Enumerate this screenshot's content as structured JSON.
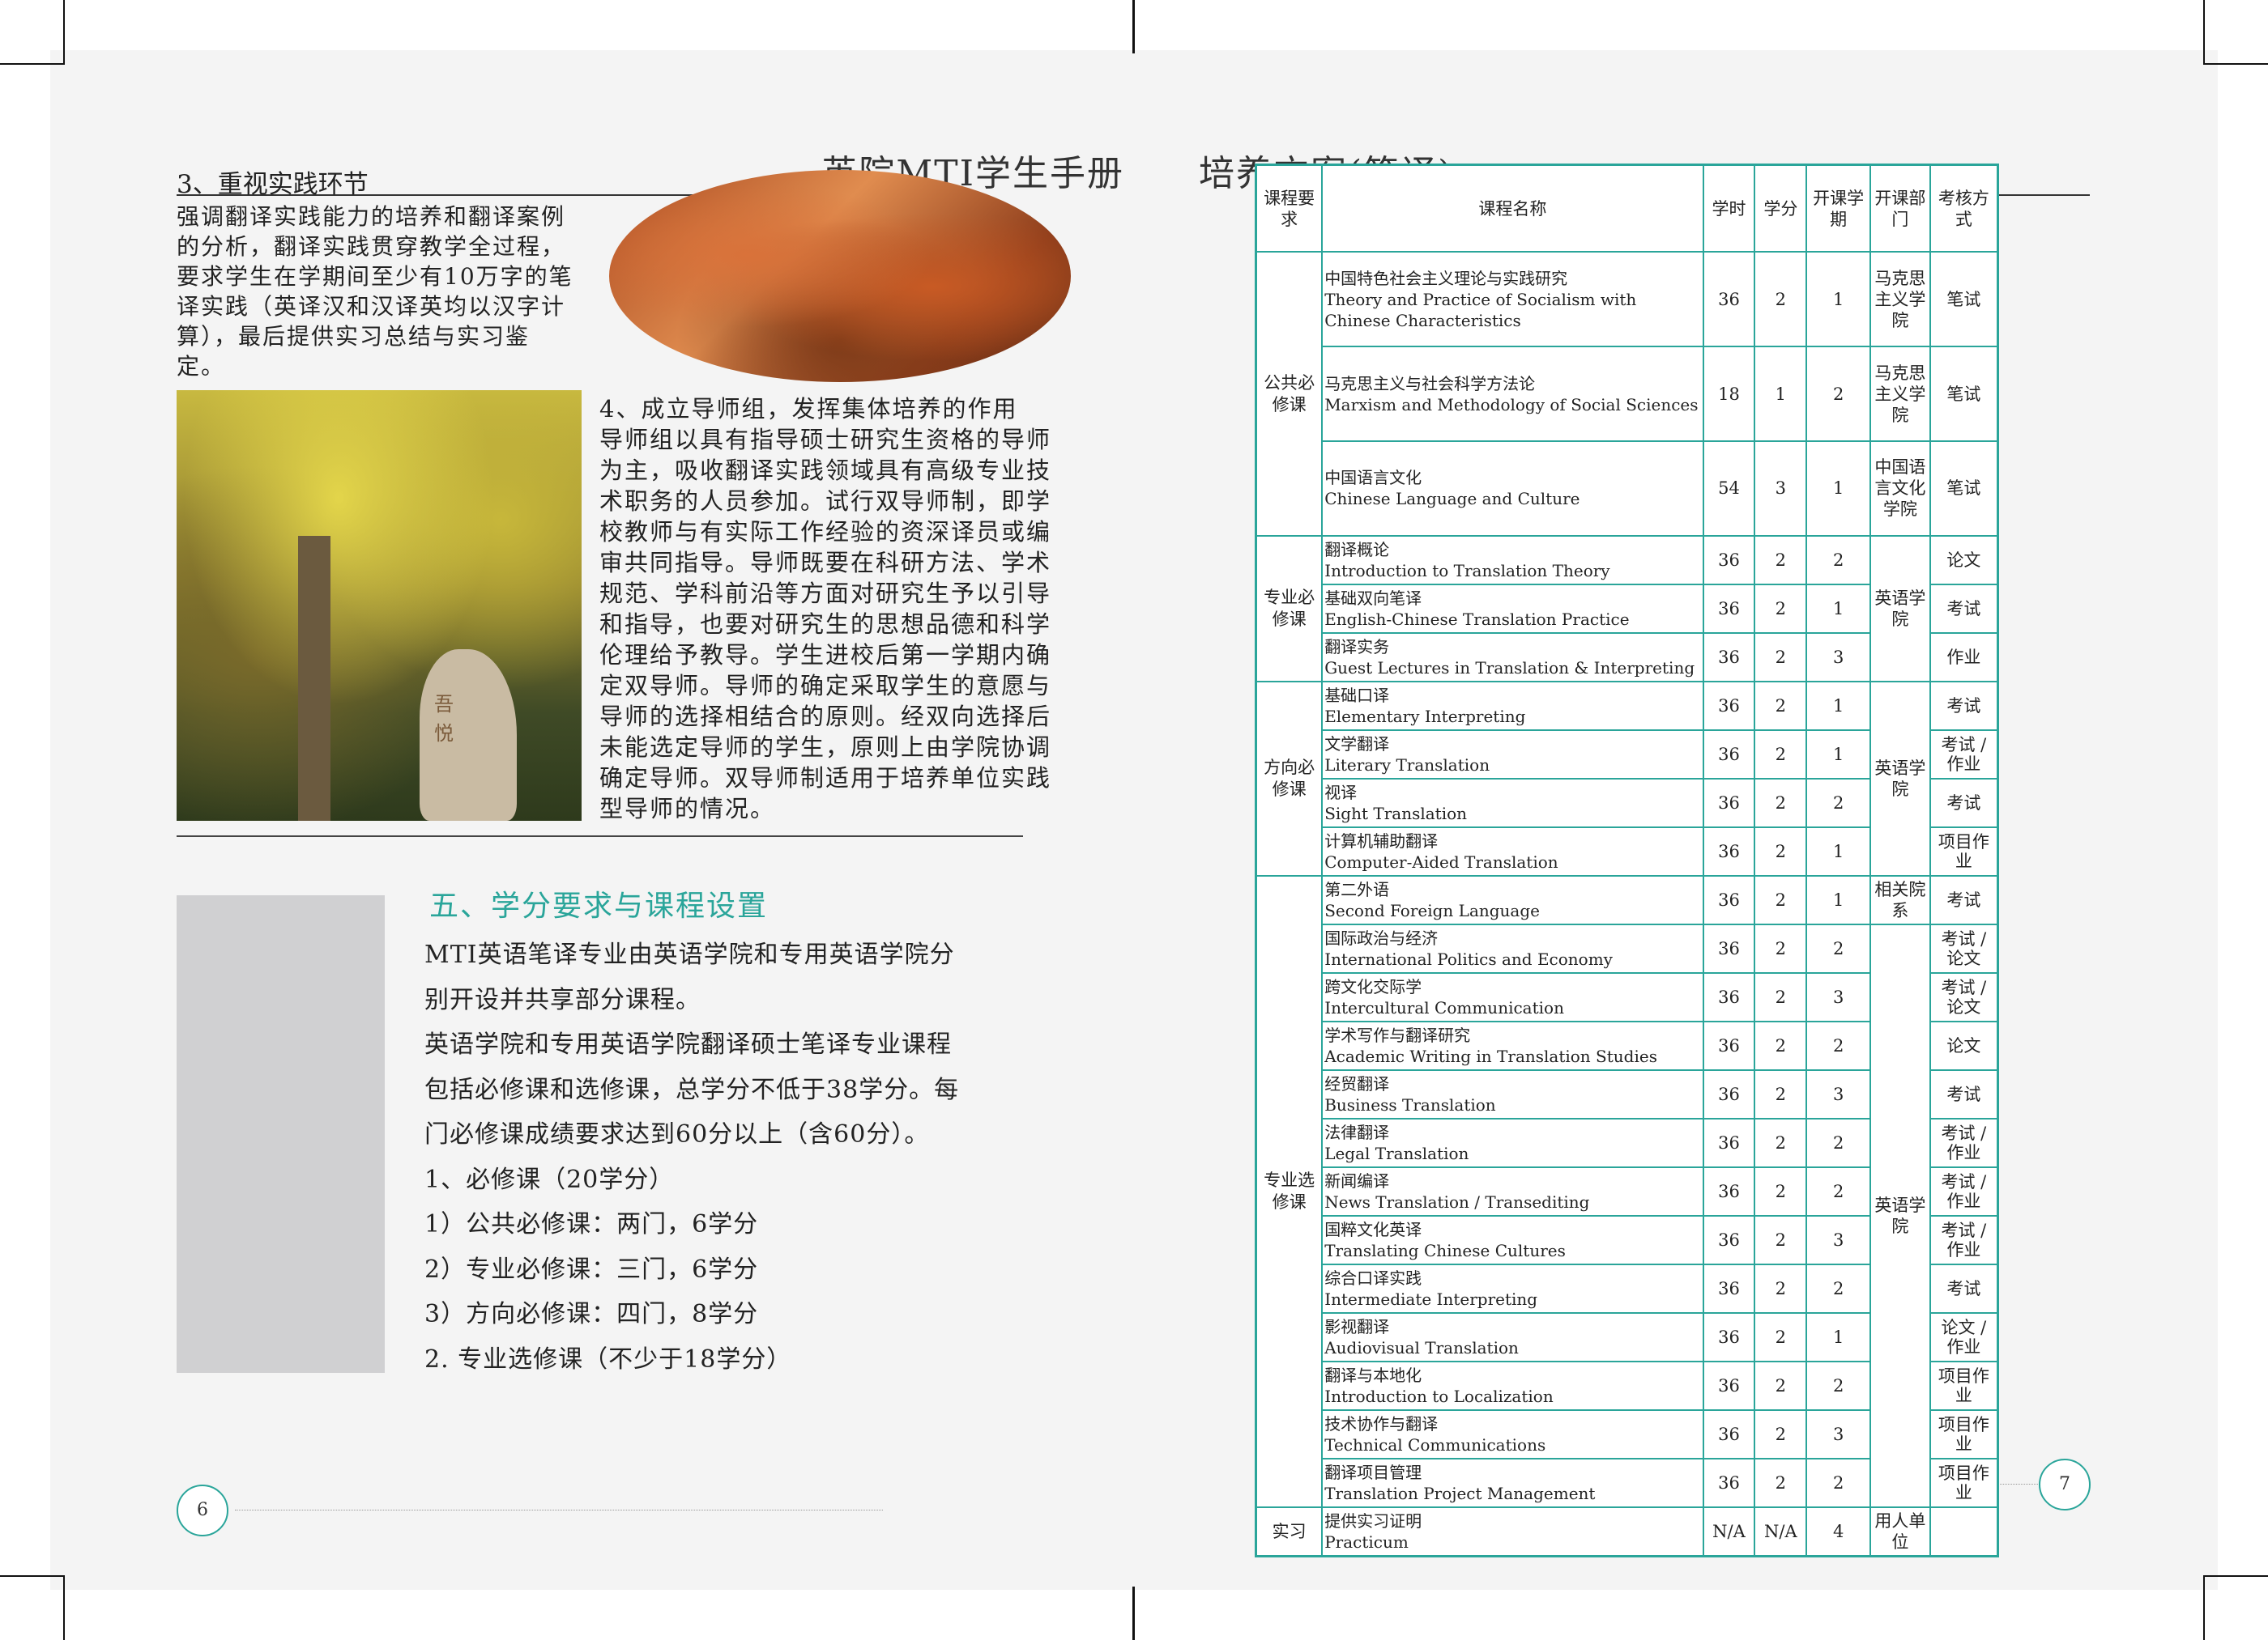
{
  "left_page": {
    "header_title": "英院MTI学生手册",
    "section3_heading": "3、重视实践环节",
    "section3_lines": [
      "强调翻译实践能力的培养和翻译案例",
      "的分析，翻译实践贯穿教学全过程，",
      "要求学生在学期间至少有10万字的笔",
      "译实践（英译汉和汉译英均以汉字计",
      "算），最后提供实习总结与实习鉴",
      "定。"
    ],
    "section4_lines": [
      "4、成立导师组，发挥集体培养的作用",
      "导师组以具有指导硕士研究生资格的导师",
      "为主，吸收翻译实践领域具有高级专业技",
      "术职务的人员参加。试行双导师制，即学",
      "校教师与有实际工作经验的资深译员或编",
      "审共同指导。导师既要在科研方法、学术",
      "规范、学科前沿等方面对研究生予以引导",
      "和指导，也要对研究生的思想品德和科学",
      "伦理给予教导。学生进校后第一学期内确",
      "定双导师。导师的确定采取学生的意愿与",
      "导师的选择相结合的原则。经双向选择后",
      "未能选定导师的学生，原则上由学院协调",
      "确定导师。双导师制适用于培养单位实践",
      "型导师的情况。"
    ],
    "stone_text": "吾悦",
    "section5_title": "五、学分要求与课程设置",
    "section5_lines": [
      "MTI英语笔译专业由英语学院和专用英语学院分",
      "别开设并共享部分课程。",
      "英语学院和专用英语学院翻译硕士笔译专业课程",
      "包括必修课和选修课，总学分不低于38学分。每",
      "门必修课成绩要求达到60分以上（含60分）。",
      "1、必修课（20学分）",
      "1）公共必修课：两门，6学分",
      "2）专业必修课：三门，6学分",
      "3）方向必修课：四门，8学分",
      "2. 专业选修课（不少于18学分）"
    ],
    "page_number": "6"
  },
  "right_page": {
    "header_title": "培养方案(笔译)",
    "page_number": "7",
    "table": {
      "headers": [
        "课程要求",
        "课程名称",
        "学时",
        "学分",
        "开课学期",
        "开课部门",
        "考核方式"
      ],
      "categories": {
        "public": "公共必修课",
        "major_req": "专业必修课",
        "direction_req": "方向必修课",
        "elective": "专业选修课",
        "practicum": "实习"
      },
      "departments": {
        "marx": "马克思主义学院",
        "chinese": "中国语言文化学院",
        "english_a": "英语学院",
        "english_b": "英语学院",
        "related": "相关院系",
        "english_c": "英语学院",
        "employer": "用人单位"
      },
      "rows": [
        {
          "cn": "中国特色社会主义理论与实践研究",
          "en": "Theory and Practice of Socialism with Chinese Characteristics",
          "hours": "36",
          "credits": "2",
          "term": "1",
          "assess": "笔试"
        },
        {
          "cn": "马克思主义与社会科学方法论",
          "en": "Marxism and Methodology of Social Sciences",
          "hours": "18",
          "credits": "1",
          "term": "2",
          "assess": "笔试"
        },
        {
          "cn": "中国语言文化",
          "en": "Chinese Language and Culture",
          "hours": "54",
          "credits": "3",
          "term": "1",
          "assess": "笔试"
        },
        {
          "cn": "翻译概论",
          "en": "Introduction to Translation Theory",
          "hours": "36",
          "credits": "2",
          "term": "2",
          "assess": "论文"
        },
        {
          "cn": "基础双向笔译",
          "en": "English-Chinese Translation Practice",
          "hours": "36",
          "credits": "2",
          "term": "1",
          "assess": "考试"
        },
        {
          "cn": "翻译实务",
          "en": "Guest Lectures in Translation & Interpreting",
          "hours": "36",
          "credits": "2",
          "term": "3",
          "assess": "作业"
        },
        {
          "cn": "基础口译",
          "en": "Elementary Interpreting",
          "hours": "36",
          "credits": "2",
          "term": "1",
          "assess": "考试"
        },
        {
          "cn": "文学翻译",
          "en": "Literary Translation",
          "hours": "36",
          "credits": "2",
          "term": "1",
          "assess": "考试 / 作业"
        },
        {
          "cn": "视译",
          "en": "Sight Translation",
          "hours": "36",
          "credits": "2",
          "term": "2",
          "assess": "考试"
        },
        {
          "cn": "计算机辅助翻译",
          "en": "Computer-Aided Translation",
          "hours": "36",
          "credits": "2",
          "term": "1",
          "assess": "项目作业"
        },
        {
          "cn": "第二外语",
          "en": "Second Foreign Language",
          "hours": "36",
          "credits": "2",
          "term": "1",
          "assess": "考试"
        },
        {
          "cn": "国际政治与经济",
          "en": "International Politics and Economy",
          "hours": "36",
          "credits": "2",
          "term": "2",
          "assess": "考试 / 论文"
        },
        {
          "cn": "跨文化交际学",
          "en": "Intercultural Communication",
          "hours": "36",
          "credits": "2",
          "term": "3",
          "assess": "考试 / 论文"
        },
        {
          "cn": "学术写作与翻译研究",
          "en": "Academic Writing in Translation Studies",
          "hours": "36",
          "credits": "2",
          "term": "2",
          "assess": "论文"
        },
        {
          "cn": "经贸翻译",
          "en": "Business Translation",
          "hours": "36",
          "credits": "2",
          "term": "3",
          "assess": "考试"
        },
        {
          "cn": "法律翻译",
          "en": "Legal Translation",
          "hours": "36",
          "credits": "2",
          "term": "2",
          "assess": "考试 / 作业"
        },
        {
          "cn": "新闻编译",
          "en": "News Translation / Transediting",
          "hours": "36",
          "credits": "2",
          "term": "2",
          "assess": "考试 / 作业"
        },
        {
          "cn": "国粹文化英译",
          "en": "Translating Chinese Cultures",
          "hours": "36",
          "credits": "2",
          "term": "3",
          "assess": "考试 / 作业"
        },
        {
          "cn": "综合口译实践",
          "en": "Intermediate Interpreting",
          "hours": "36",
          "credits": "2",
          "term": "2",
          "assess": "考试"
        },
        {
          "cn": "影视翻译",
          "en": "Audiovisual Translation",
          "hours": "36",
          "credits": "2",
          "term": "1",
          "assess": "论文 / 作业"
        },
        {
          "cn": "翻译与本地化",
          "en": "Introduction to Localization",
          "hours": "36",
          "credits": "2",
          "term": "2",
          "assess": "项目作业"
        },
        {
          "cn": "技术协作与翻译",
          "en": "Technical Communications",
          "hours": "36",
          "credits": "2",
          "term": "3",
          "assess": "项目作业"
        },
        {
          "cn": "翻译项目管理",
          "en": "Translation Project Management",
          "hours": "36",
          "credits": "2",
          "term": "2",
          "assess": "项目作业"
        },
        {
          "cn": "提供实习证明",
          "en": "Practicum",
          "hours": "N/A",
          "credits": "N/A",
          "term": "4",
          "assess": ""
        }
      ]
    }
  },
  "colors": {
    "accent_teal": "#2aa59a",
    "placeholder_gray": "#d0d0d2"
  }
}
